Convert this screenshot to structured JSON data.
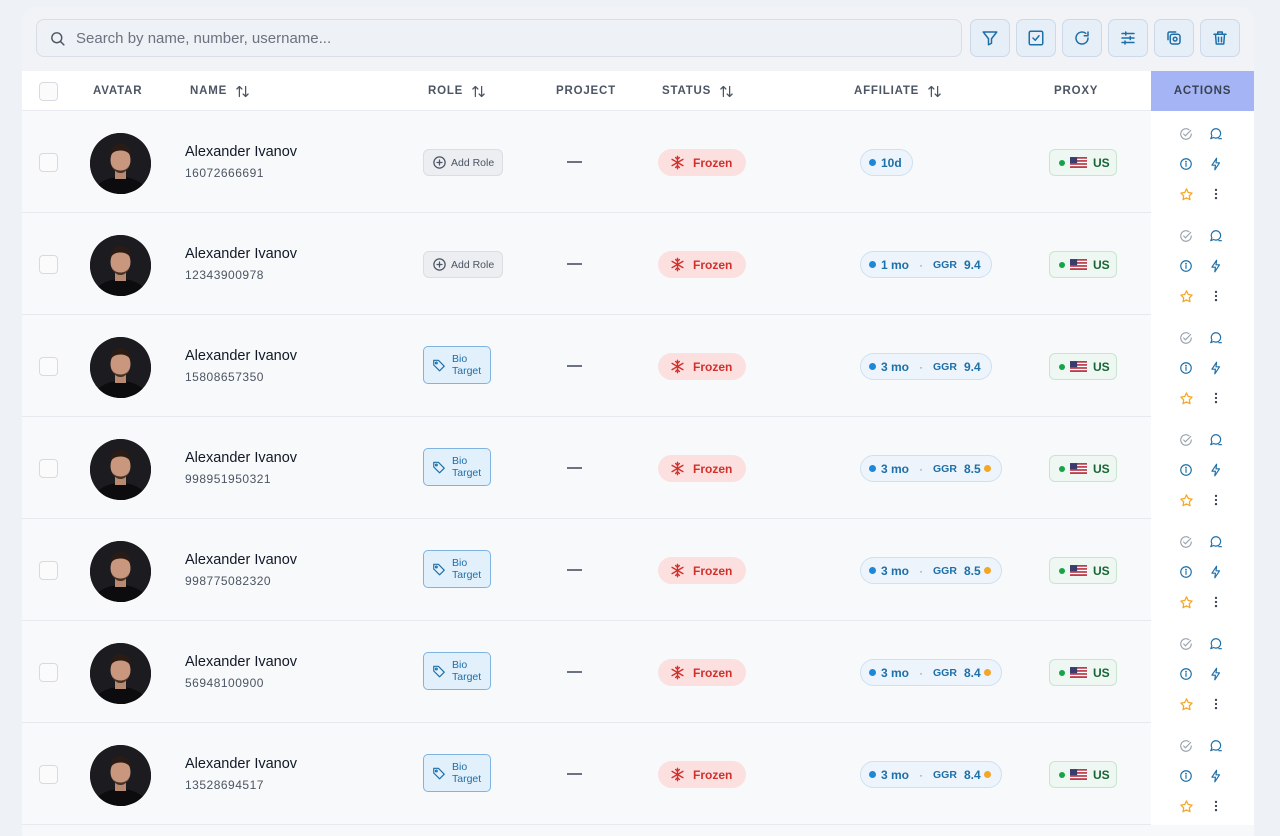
{
  "search": {
    "placeholder": "Search by name, number, username..."
  },
  "toolbar": {
    "buttons": [
      "filter-icon",
      "checkbox-icon",
      "refresh-icon",
      "sliders-icon",
      "copy-icon",
      "trash-icon"
    ]
  },
  "columns": {
    "avatar": "AVATAR",
    "name": "NAME",
    "role": "ROLE",
    "project": "PROJECT",
    "status": "STATUS",
    "affiliate": "AFFILIATE",
    "proxy": "PROXY",
    "actions": "ACTIONS"
  },
  "labels": {
    "add_role": "Add Role",
    "tag_line1": "Bio",
    "tag_line2": "Target",
    "project_empty": "—",
    "status_frozen": "Frozen",
    "ggr": "GGR",
    "proxy_country": "US"
  },
  "colors": {
    "actions_header": "#a5b4f5",
    "frozen_bg": "#fbe0df",
    "frozen_text": "#d0312d",
    "affiliate_text": "#1d6fa8",
    "proxy_online": "#16a34a",
    "star": "#f5a623"
  },
  "rows": [
    {
      "name": "Alexander Ivanov",
      "phone": "16072666691",
      "role": "add",
      "status": "Frozen",
      "affiliate_age": "10d",
      "ggr": null,
      "ggr_flag": false,
      "proxy": "US"
    },
    {
      "name": "Alexander Ivanov",
      "phone": "12343900978",
      "role": "add",
      "status": "Frozen",
      "affiliate_age": "1 mo",
      "ggr": "9.4",
      "ggr_flag": false,
      "proxy": "US"
    },
    {
      "name": "Alexander Ivanov",
      "phone": "15808657350",
      "role": "tag",
      "status": "Frozen",
      "affiliate_age": "3 mo",
      "ggr": "9.4",
      "ggr_flag": false,
      "proxy": "US"
    },
    {
      "name": "Alexander Ivanov",
      "phone": "998951950321",
      "role": "tag",
      "status": "Frozen",
      "affiliate_age": "3 mo",
      "ggr": "8.5",
      "ggr_flag": true,
      "proxy": "US"
    },
    {
      "name": "Alexander Ivanov",
      "phone": "998775082320",
      "role": "tag",
      "status": "Frozen",
      "affiliate_age": "3 mo",
      "ggr": "8.5",
      "ggr_flag": true,
      "proxy": "US"
    },
    {
      "name": "Alexander Ivanov",
      "phone": "56948100900",
      "role": "tag",
      "status": "Frozen",
      "affiliate_age": "3 mo",
      "ggr": "8.4",
      "ggr_flag": true,
      "proxy": "US"
    },
    {
      "name": "Alexander Ivanov",
      "phone": "13528694517",
      "role": "tag",
      "status": "Frozen",
      "affiliate_age": "3 mo",
      "ggr": "8.4",
      "ggr_flag": true,
      "proxy": "US"
    }
  ]
}
